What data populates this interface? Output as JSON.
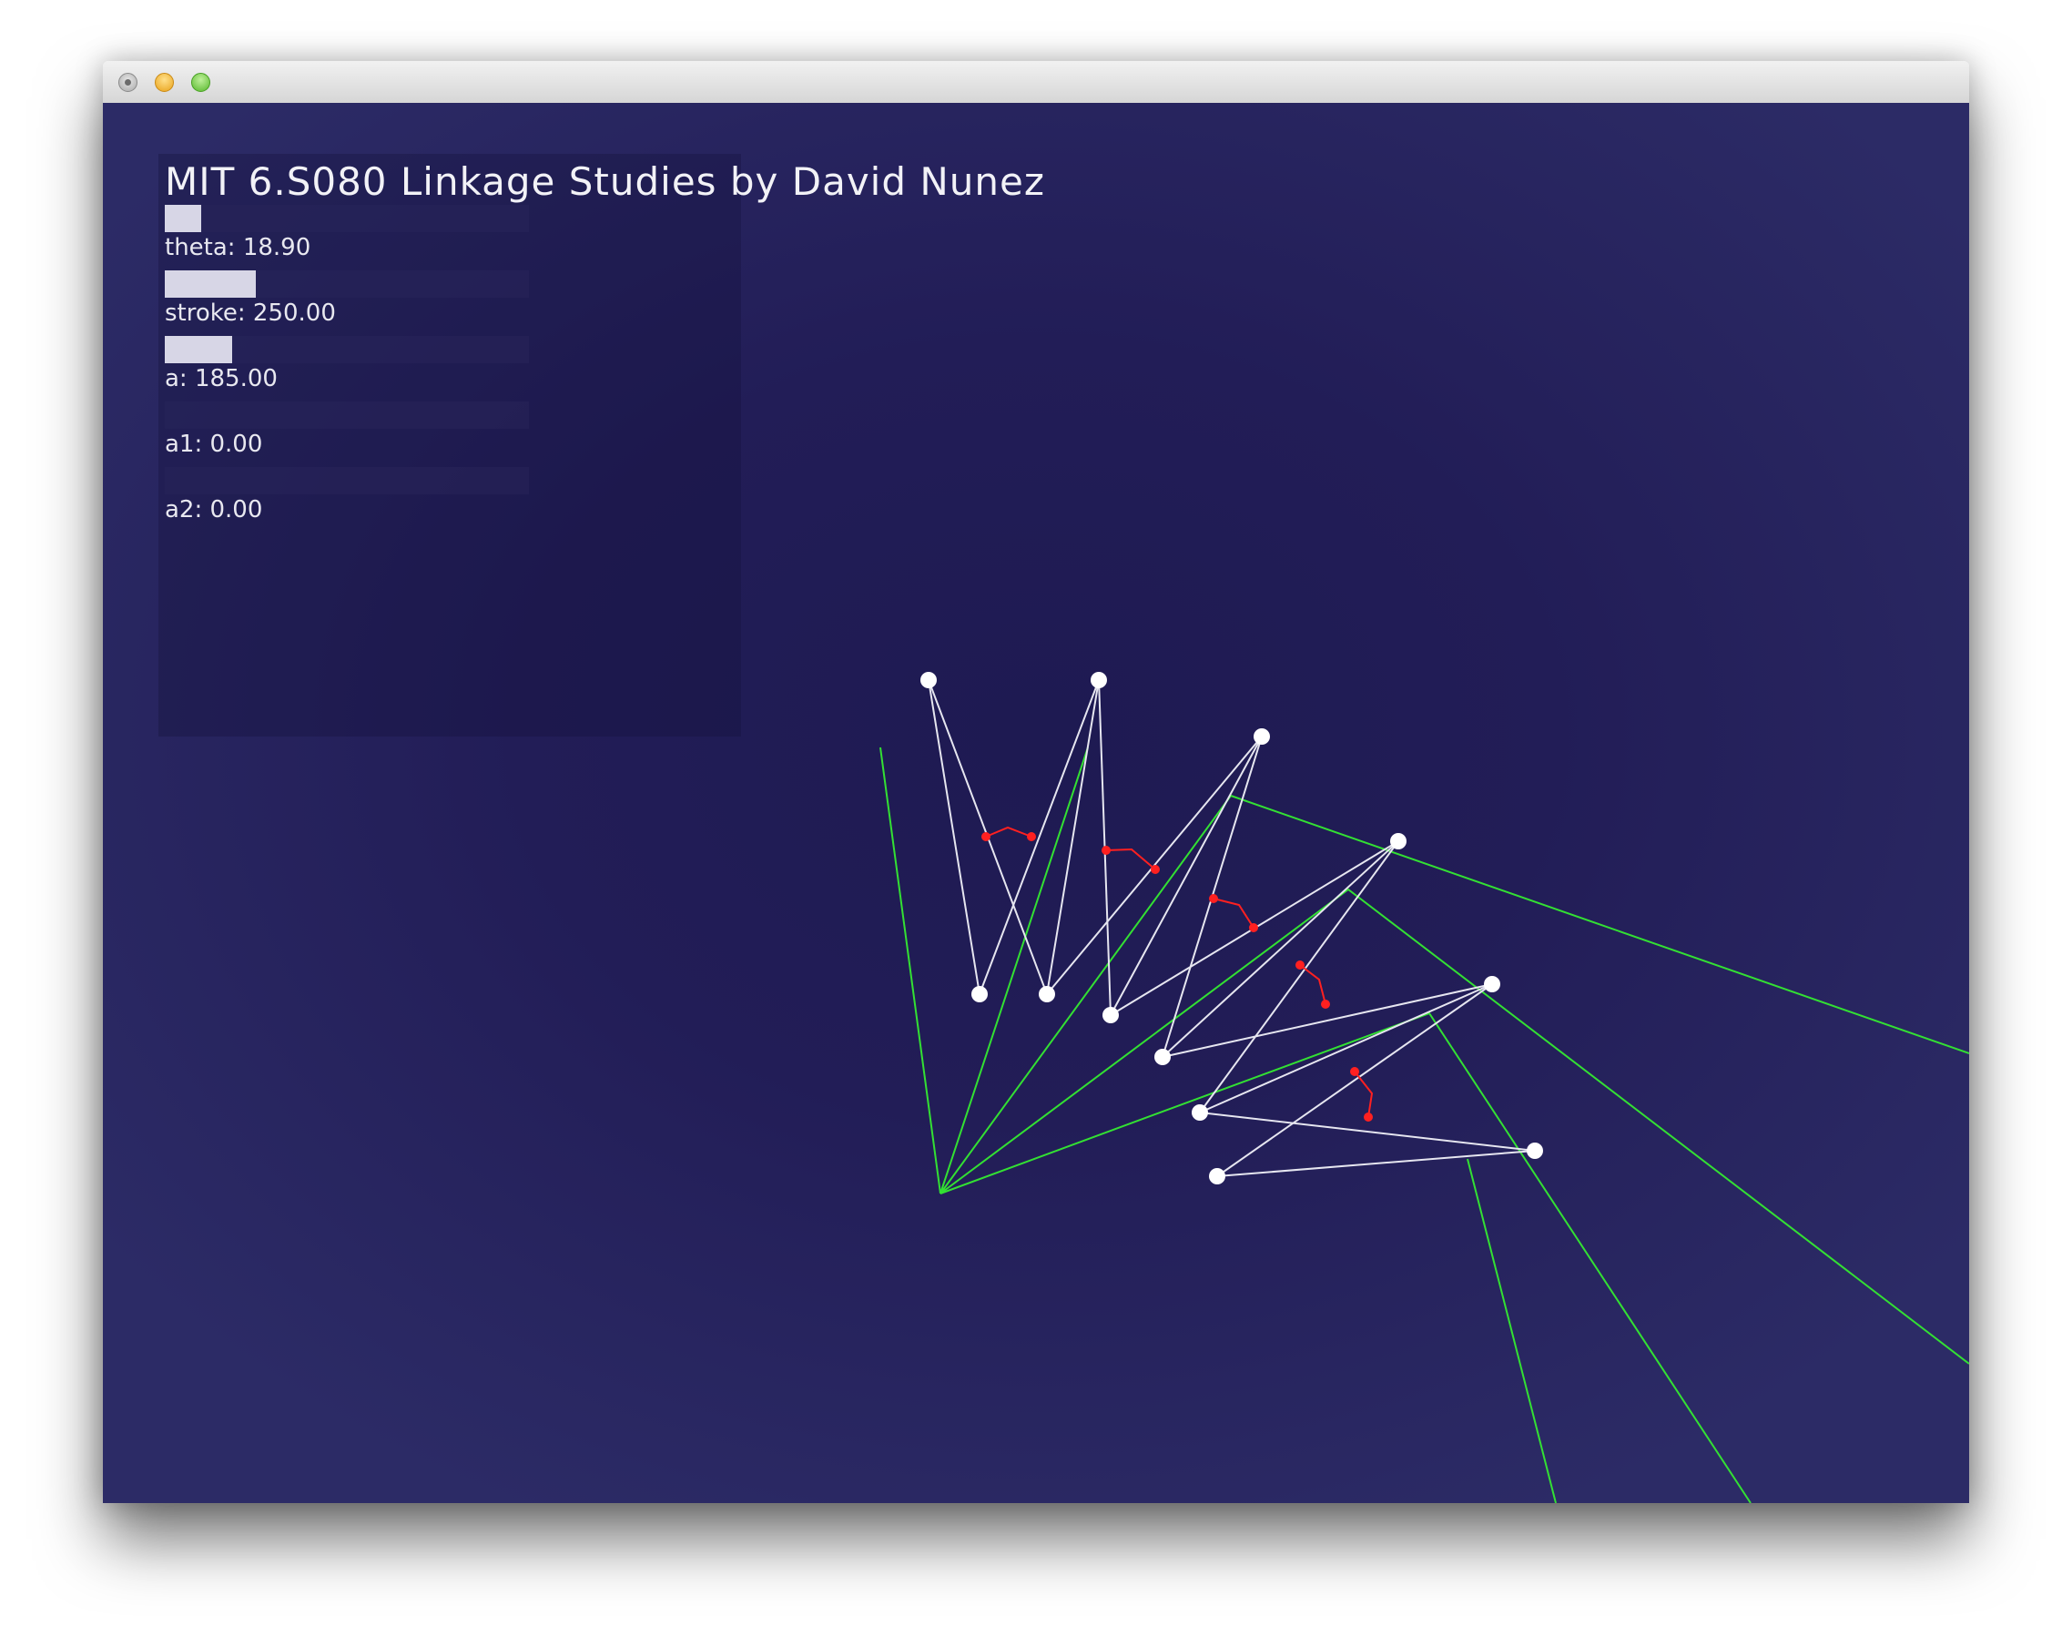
{
  "window": {
    "controls": [
      "close-button",
      "minimize-button",
      "maximize-button"
    ]
  },
  "app": {
    "title": "MIT 6.S080 Linkage Studies by David Nunez"
  },
  "sliders": [
    {
      "id": "theta",
      "label": "theta: 18.90",
      "value": 18.9,
      "fill_fraction": 0.1
    },
    {
      "id": "stroke",
      "label": "stroke: 250.00",
      "value": 250.0,
      "fill_fraction": 0.25
    },
    {
      "id": "a",
      "label": "a: 185.00",
      "value": 185.0,
      "fill_fraction": 0.185
    },
    {
      "id": "a1",
      "label": "a1: 0.00",
      "value": 0.0,
      "fill_fraction": 0.0
    },
    {
      "id": "a2",
      "label": "a2: 0.00",
      "value": 0.0,
      "fill_fraction": 0.0
    }
  ],
  "colors": {
    "background": "#221d57",
    "link_white": "#e6e6f0",
    "ray_green": "#33e033",
    "joint_red": "#ff2020",
    "node_white": "#ffffff"
  }
}
